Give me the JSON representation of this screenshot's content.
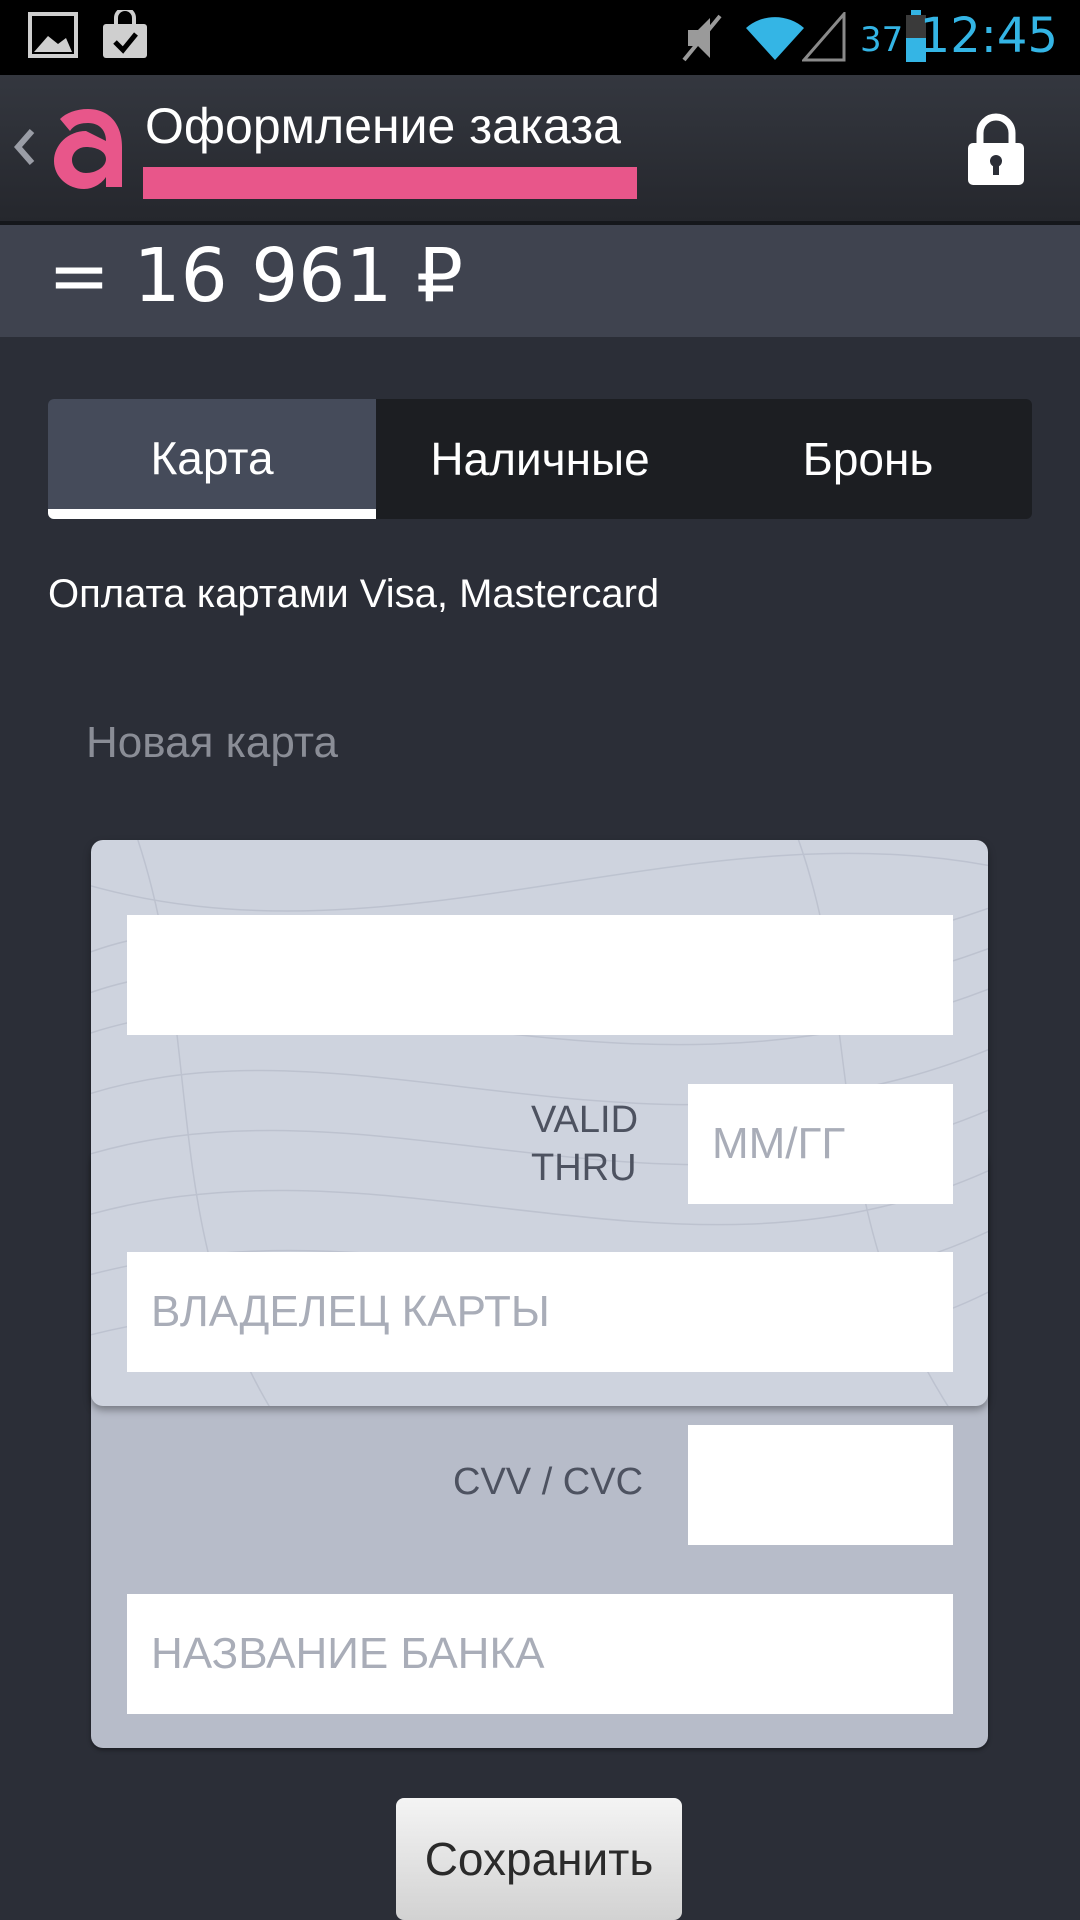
{
  "status_bar": {
    "battery": "37",
    "time": "12:45"
  },
  "header": {
    "title": "Оформление заказа"
  },
  "order": {
    "total": "= 16 961 ₽"
  },
  "payment_tabs": [
    {
      "label": "Карта",
      "active": true
    },
    {
      "label": "Наличные",
      "active": false
    },
    {
      "label": "Бронь",
      "active": false
    }
  ],
  "payment": {
    "note": "Оплата картами Visa, Mastercard",
    "new_card_label": "Новая карта"
  },
  "card_form": {
    "card_number_value": "",
    "valid_thru_label_1": "VALID",
    "valid_thru_label_2": "THRU",
    "expiry_placeholder": "ММ/ГГ",
    "holder_placeholder": "ВЛАДЕЛЕЦ КАРТЫ",
    "cvv_label": "CVV / CVC",
    "bank_placeholder": "НАЗВАНИЕ БАНКА"
  },
  "actions": {
    "save_label": "Сохранить"
  },
  "colors": {
    "accent": "#e8568a",
    "status_blue": "#34b5e5",
    "background": "#2b2e37"
  }
}
